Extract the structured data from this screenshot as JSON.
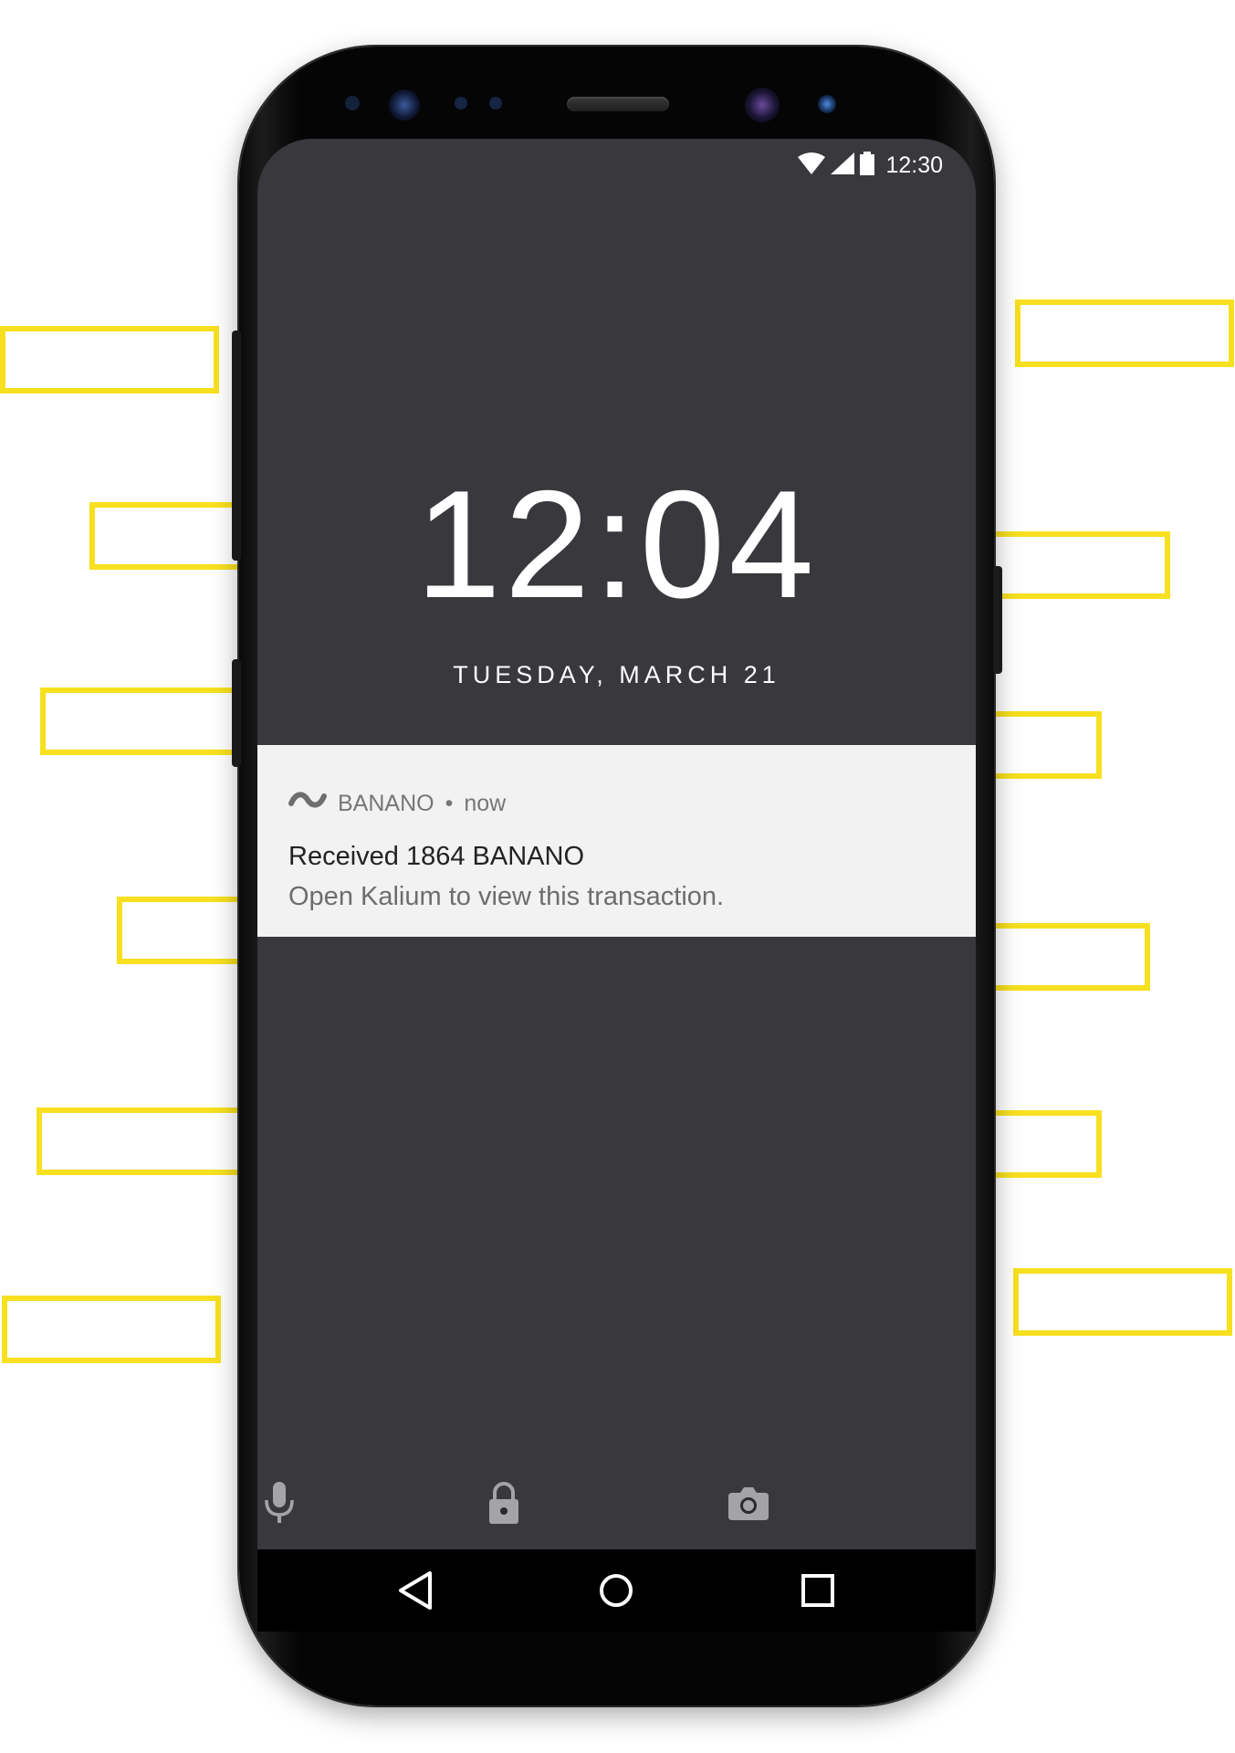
{
  "status_bar": {
    "time": "12:30",
    "icons": [
      "wifi-icon",
      "cell-signal-icon",
      "battery-icon"
    ]
  },
  "lock_screen": {
    "clock": "12:04",
    "date": "TUESDAY, MARCH 21"
  },
  "notification": {
    "app_icon": "banano-wave-icon",
    "app_name": "BANANO",
    "separator": "•",
    "time": "now",
    "title": "Received 1864 BANANO",
    "body": "Open Kalium to view this transaction."
  },
  "shortcuts": {
    "left": "microphone-icon",
    "center": "lock-icon",
    "right": "camera-icon"
  },
  "navigation": {
    "back": "back-icon",
    "home": "home-icon",
    "recents": "recents-icon"
  },
  "colors": {
    "accent_frame": "#f7e01f",
    "screen_bg": "#2a2a2e",
    "notification_bg": "#f3f2f3"
  }
}
